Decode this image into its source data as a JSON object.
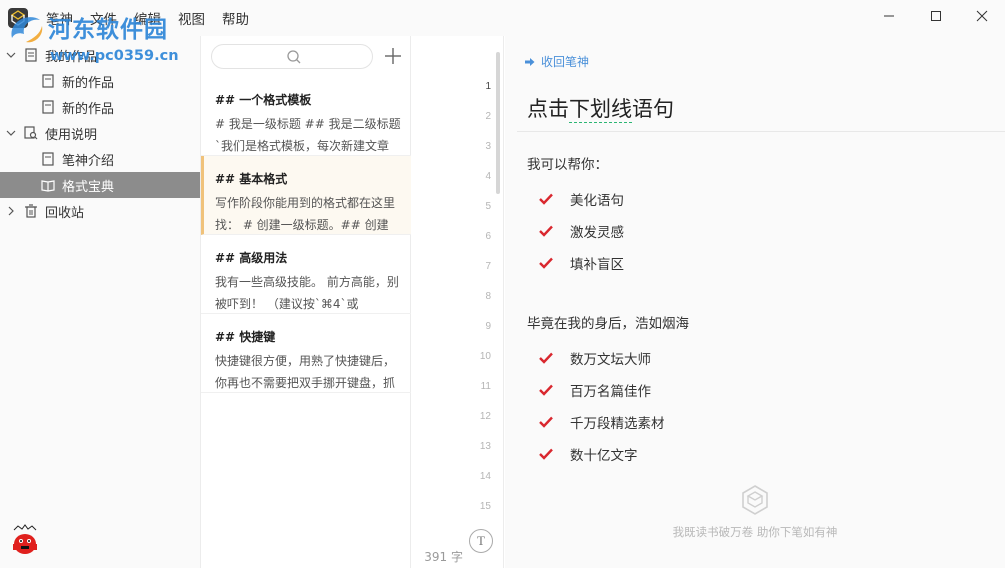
{
  "menu": [
    "笔神",
    "文件",
    "编辑",
    "视图",
    "帮助"
  ],
  "watermark": {
    "title": "河东软件园",
    "url": "www.pc0359.cn"
  },
  "window_controls": [
    "minimize-icon",
    "maximize-icon",
    "close-icon"
  ],
  "sidebar": {
    "items": [
      {
        "label": "我的作品",
        "icon": "stack-icon",
        "expanded": true
      },
      {
        "label": "新的作品",
        "icon": "document-icon"
      },
      {
        "label": "新的作品",
        "icon": "document-icon"
      },
      {
        "label": "使用说明",
        "icon": "search-doc-icon",
        "expanded": true
      },
      {
        "label": "笔神介绍",
        "icon": "document-icon"
      },
      {
        "label": "格式宝典",
        "icon": "book-icon",
        "selected": true
      },
      {
        "label": "回收站",
        "icon": "trash-icon",
        "expanded": false
      }
    ]
  },
  "doclist": {
    "items": [
      {
        "title": "## 一个格式模板",
        "preview": "# 我是一级标题 ## 我是二级标题 `我们是格式模板，每次新建文章"
      },
      {
        "title": "## 基本格式",
        "preview": "写作阶段你能用到的格式都在这里找： # 创建一级标题。## 创建",
        "active": true
      },
      {
        "title": "## 高级用法",
        "preview": "我有一些高级技能。 前方高能，别被吓到！ （建议按`⌘4`或"
      },
      {
        "title": "## 快捷键",
        "preview": "快捷键很方便，用熟了快捷键后，你再也不需要把双手挪开键盘，抓"
      }
    ]
  },
  "editor": {
    "line_numbers": [
      "1",
      "2",
      "3",
      "4",
      "5",
      "6",
      "7",
      "8",
      "9",
      "10",
      "11",
      "12",
      "13",
      "14",
      "15"
    ],
    "current_line": "1",
    "word_count": "391 字",
    "typewriter_glyph": "T"
  },
  "panel": {
    "collapse_label": "收回笔神",
    "heading_prefix": "点击",
    "heading_underlined": "下划线",
    "heading_suffix": "语句",
    "section1_title": "我可以帮你：",
    "section1_items": [
      "美化语句",
      "激发灵感",
      "填补盲区"
    ],
    "section2_title": "毕竟在我的身后，浩如烟海",
    "section2_items": [
      "数万文坛大师",
      "百万名篇佳作",
      "千万段精选素材",
      "数十亿文字"
    ],
    "slogan": "我既读书破万卷 助你下笔如有神"
  },
  "colors": {
    "accent_blue": "#4a90d9",
    "check_red": "#d9272e",
    "underline_green": "#2bb673",
    "selected_bg": "#8c8c8c",
    "active_doc_bar": "#f0c27a",
    "watermark_blue": "#2f87d8"
  }
}
